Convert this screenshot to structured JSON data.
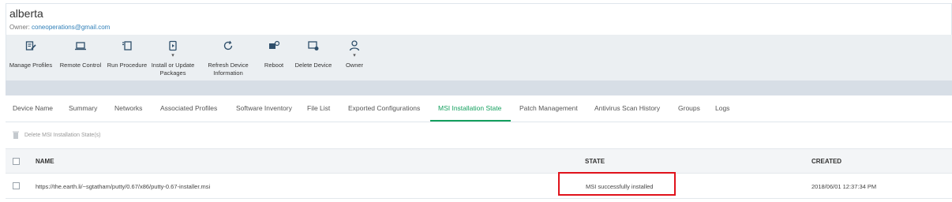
{
  "device": {
    "name": "alberta",
    "owner_label": "Owner:",
    "owner_email": "coneoperations@gmail.com"
  },
  "toolbar": {
    "items": [
      {
        "label_line1": "Manage Profiles",
        "label_line2": "",
        "icon": "manage-profiles-icon"
      },
      {
        "label_line1": "Remote Control",
        "label_line2": "",
        "icon": "laptop-icon"
      },
      {
        "label_line1": "Run Procedure",
        "label_line2": "",
        "icon": "run-procedure-icon"
      },
      {
        "label_line1": "Install or Update",
        "label_line2": "Packages",
        "icon": "package-icon"
      },
      {
        "label_line1": "Refresh Device",
        "label_line2": "Information",
        "icon": "refresh-icon"
      },
      {
        "label_line1": "Reboot",
        "label_line2": "",
        "icon": "reboot-icon"
      },
      {
        "label_line1": "Delete Device",
        "label_line2": "",
        "icon": "delete-device-icon"
      },
      {
        "label_line1": "Owner",
        "label_line2": "",
        "icon": "owner-icon"
      }
    ],
    "caret": "▾"
  },
  "tabs": [
    "Device Name",
    "Summary",
    "Networks",
    "Associated Profiles",
    "Software Inventory",
    "File List",
    "Exported Configurations",
    "MSI Installation State",
    "Patch Management",
    "Antivirus Scan History",
    "Groups",
    "Logs"
  ],
  "active_tab": "MSI Installation State",
  "actions": {
    "delete_label": "Delete MSI Installation State(s)"
  },
  "table": {
    "columns": [
      "NAME",
      "STATE",
      "CREATED"
    ],
    "rows": [
      {
        "name": "https://the.earth.li/~sgtatham/putty/0.67/x86/putty-0.67-installer.msi",
        "state": "MSI successfully installed",
        "created": "2018/06/01 12:37:34 PM"
      }
    ]
  },
  "colors": {
    "accent": "#14a05e",
    "link": "#2f7fb8",
    "highlight": "#e0121b"
  }
}
